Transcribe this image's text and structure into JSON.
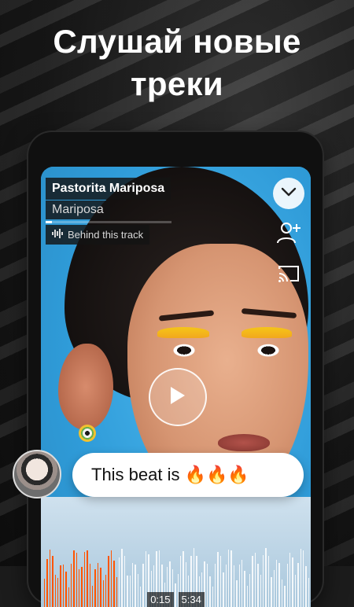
{
  "promo": {
    "title_line1": "Слушай новые",
    "title_line2": "треки"
  },
  "player": {
    "track_title": "Pastorita Mariposa",
    "artist": "Mariposa",
    "behind_label": "Behind this track",
    "progress_fraction": 0.047,
    "time_current": "0:15",
    "time_total": "5:34",
    "icons": {
      "collapse": "chevron-down-icon",
      "follow": "add-user-icon",
      "cast": "cast-icon",
      "play": "play-icon",
      "waveform": "waveform-icon"
    }
  },
  "comment": {
    "text": "This beat is 🔥🔥🔥"
  },
  "colors": {
    "accent_orange": "#ff5500",
    "screen_blue": "#37a6e3"
  }
}
